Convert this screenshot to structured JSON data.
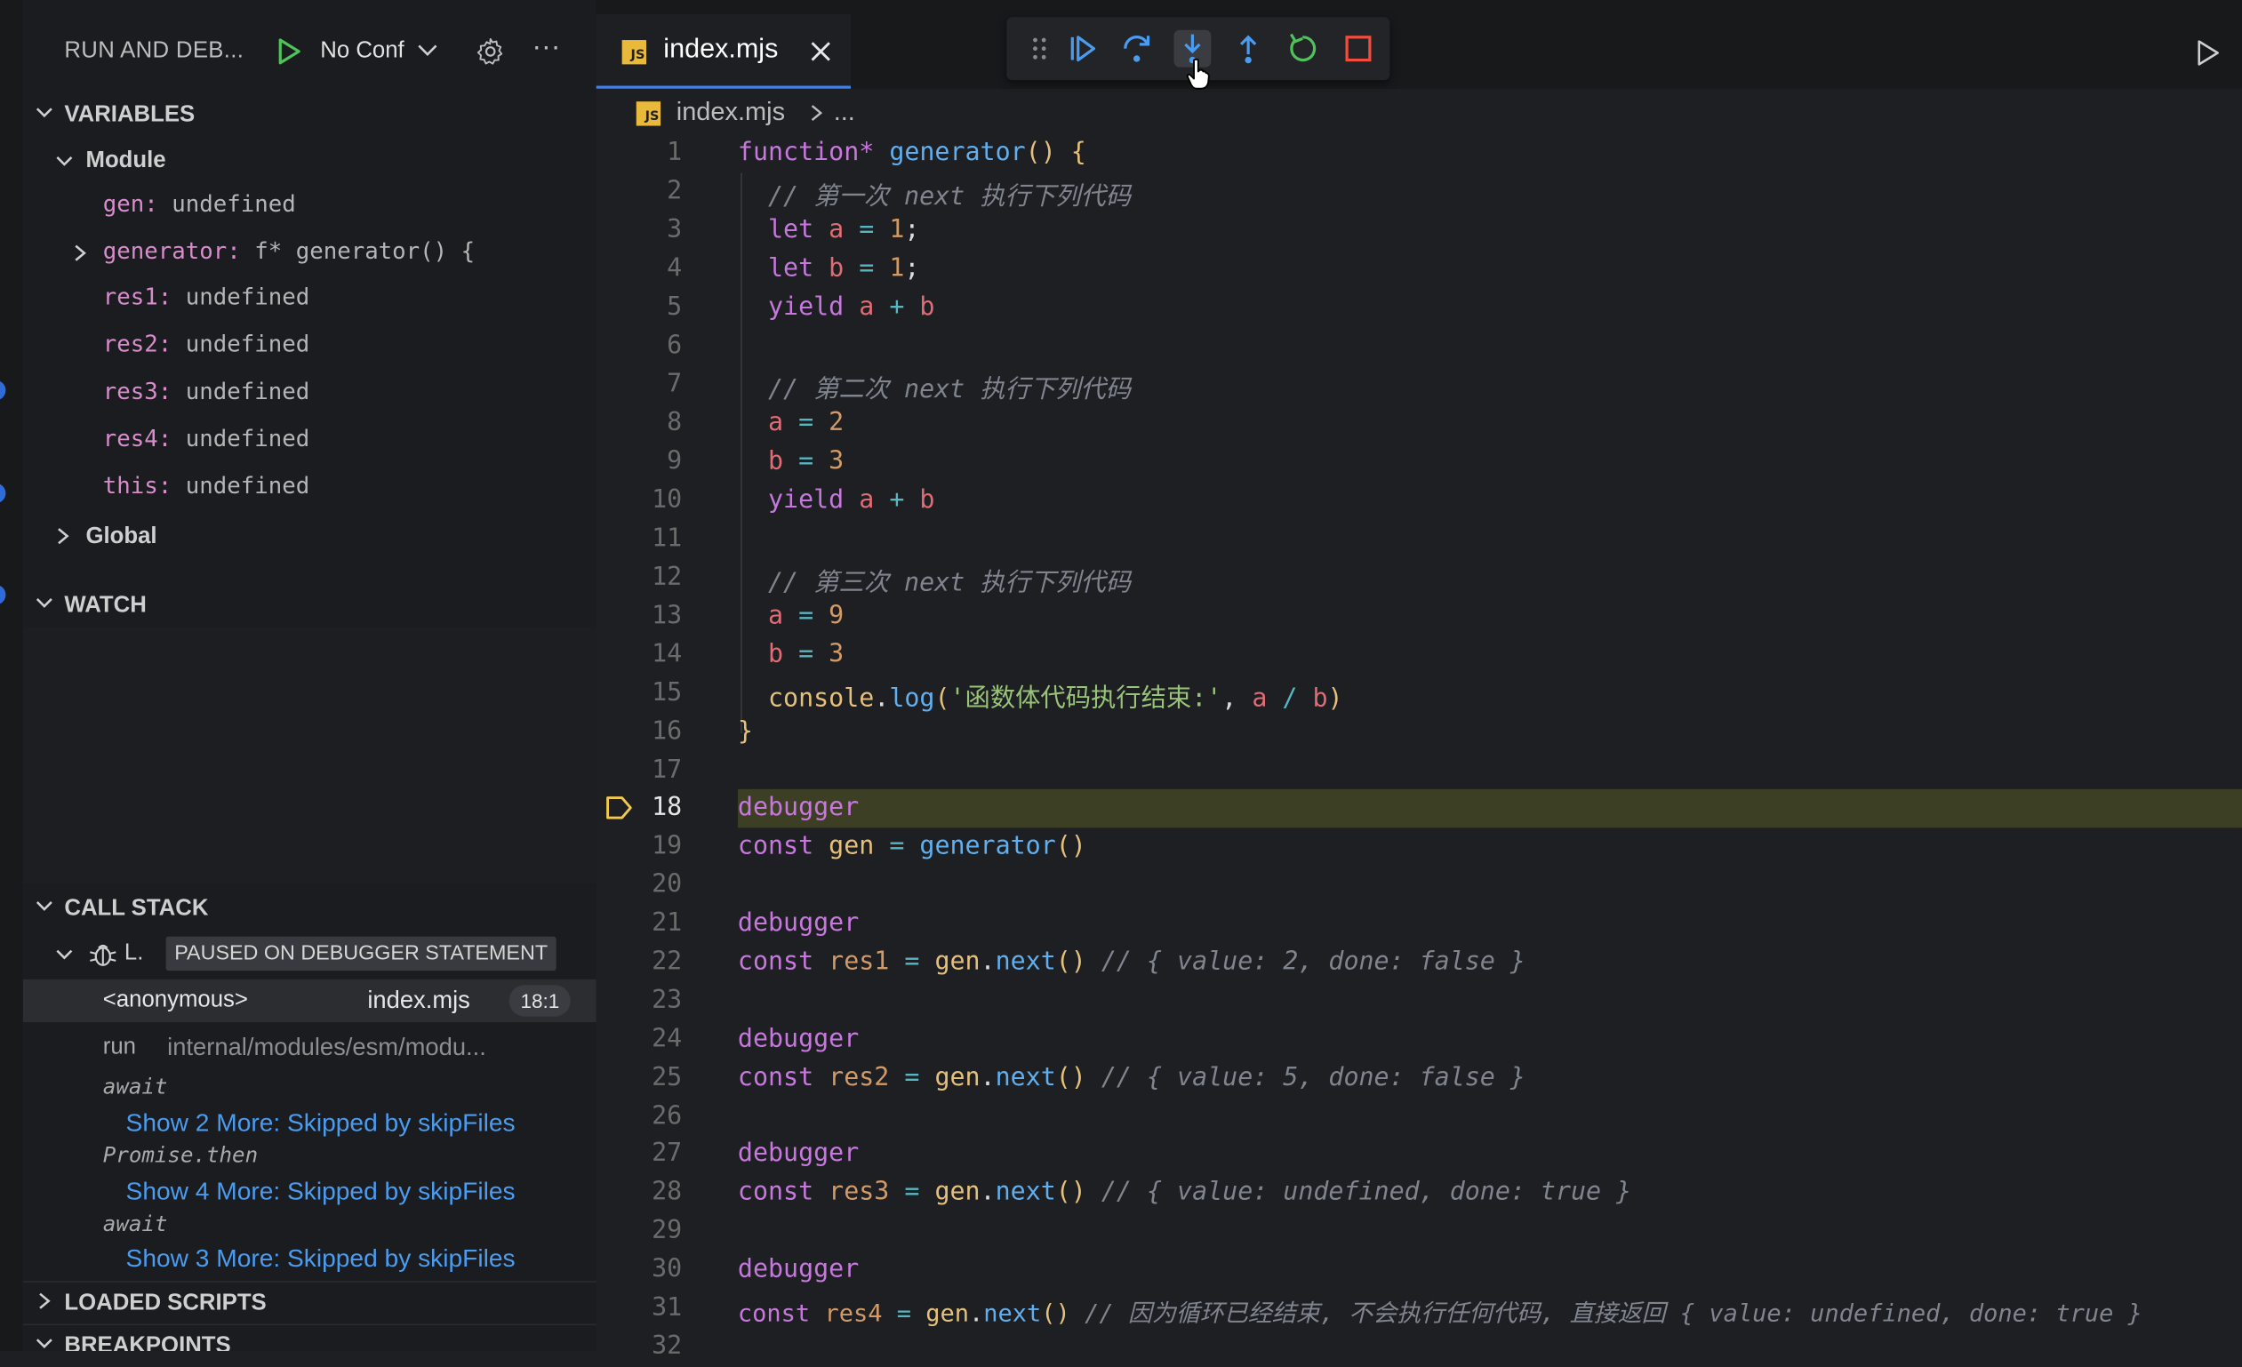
{
  "sidebar": {
    "title": "RUN AND DEB...",
    "config": "No Conf",
    "variables_header": "VARIABLES",
    "module_label": "Module",
    "variables": [
      {
        "key": "gen:",
        "value": "undefined"
      },
      {
        "key": "generator:",
        "value": "f* generator() {"
      },
      {
        "key": "res1:",
        "value": "undefined"
      },
      {
        "key": "res2:",
        "value": "undefined"
      },
      {
        "key": "res3:",
        "value": "undefined"
      },
      {
        "key": "res4:",
        "value": "undefined"
      },
      {
        "key": "this:",
        "value": "undefined"
      }
    ],
    "global_label": "Global",
    "watch_header": "WATCH",
    "callstack_header": "CALL STACK",
    "thread_label": "L.",
    "paused_badge": "PAUSED ON DEBUGGER STATEMENT",
    "frames": [
      {
        "name": "<anonymous>",
        "file": "index.mjs",
        "pos": "18:1"
      },
      {
        "name": "run",
        "file": "internal/modules/esm/modu..."
      }
    ],
    "async_labels": [
      "await",
      "Promise.then",
      "await"
    ],
    "skipped": [
      "Show 2 More: Skipped by skipFiles",
      "Show 4 More: Skipped by skipFiles",
      "Show 3 More: Skipped by skipFiles"
    ],
    "loaded_scripts_header": "LOADED SCRIPTS",
    "breakpoints_header": "BREAKPOINTS"
  },
  "editor": {
    "tab_label": "index.mjs",
    "js_badge": "JS",
    "breadcrumb_file": "index.mjs",
    "breadcrumb_more": "...",
    "current_line": 18,
    "line_numbers": [
      "1",
      "2",
      "3",
      "4",
      "5",
      "6",
      "7",
      "8",
      "9",
      "10",
      "11",
      "12",
      "13",
      "14",
      "15",
      "16",
      "17",
      "18",
      "19",
      "20",
      "21",
      "22",
      "23",
      "24",
      "25",
      "26",
      "27",
      "28",
      "29",
      "30",
      "31",
      "32"
    ]
  },
  "code": {
    "l1": [
      "function*",
      " generator",
      "() {"
    ],
    "c1": "// 第一次 next 执行下列代码",
    "c2": "// 第二次 next 执行下列代码",
    "c3": "// 第三次 next 执行下列代码",
    "log_str": "'函数体代码执行结束:'",
    "r1": "// { value: 2, done: false }",
    "r2": "// { value: 5, done: false }",
    "r3": "// { value: undefined, done: true }",
    "r4": "// 因为循环已经结束, 不会执行任何代码, 直接返回 { value: undefined, done: true }"
  },
  "colors": {
    "accent": "#3b82f6",
    "current_line_bg": "#3d3f24",
    "continue": "#4a9cf0",
    "restart": "#4fc35a",
    "stop": "#f24c3d"
  }
}
